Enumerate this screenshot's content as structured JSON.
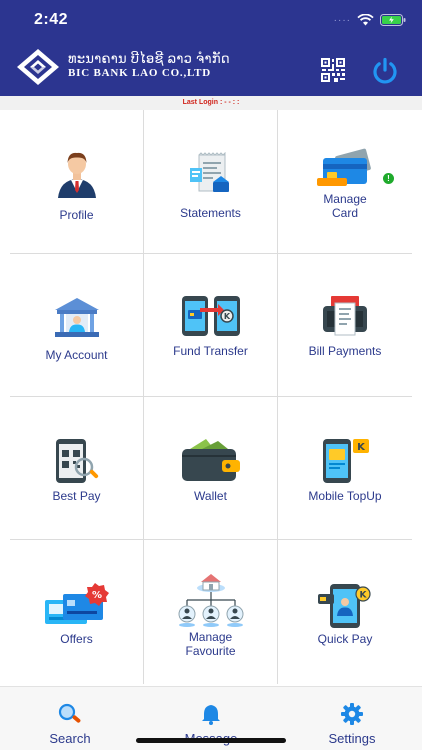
{
  "status_bar": {
    "time": "2:42",
    "signal_text": "····"
  },
  "header": {
    "bank_name_lao": "ທະນາຄານ ບີໄອຊີ ລາວ ຈໍາກັດ",
    "bank_name_en": "BIC BANK LAO CO.,LTD"
  },
  "last_login": {
    "text": "Last Login : - -   : :"
  },
  "tiles": [
    {
      "label": "Profile",
      "icon": "person-icon"
    },
    {
      "label": "Statements",
      "icon": "statement-icon"
    },
    {
      "label": "Manage Card",
      "icon": "card-icon",
      "badge": "!"
    },
    {
      "label": "My Account",
      "icon": "bank-building-icon"
    },
    {
      "label": "Fund Transfer",
      "icon": "transfer-icon"
    },
    {
      "label": "Bill Payments",
      "icon": "bill-icon"
    },
    {
      "label": "Best Pay",
      "icon": "qr-scan-icon"
    },
    {
      "label": "Wallet",
      "icon": "wallet-icon"
    },
    {
      "label": "Mobile TopUp",
      "icon": "mobile-topup-icon"
    },
    {
      "label": "Offers",
      "icon": "offer-icon"
    },
    {
      "label": "Manage Favourite",
      "icon": "favourite-network-icon"
    },
    {
      "label": "Quick Pay",
      "icon": "quick-pay-icon"
    }
  ],
  "bottom_nav": {
    "search": "Search",
    "message": "Message",
    "settings": "Settings"
  },
  "colors": {
    "brand": "#2c3590",
    "label": "#2c3a8c",
    "last_login": "#d0241b",
    "accent_blue": "#1e88e5"
  }
}
